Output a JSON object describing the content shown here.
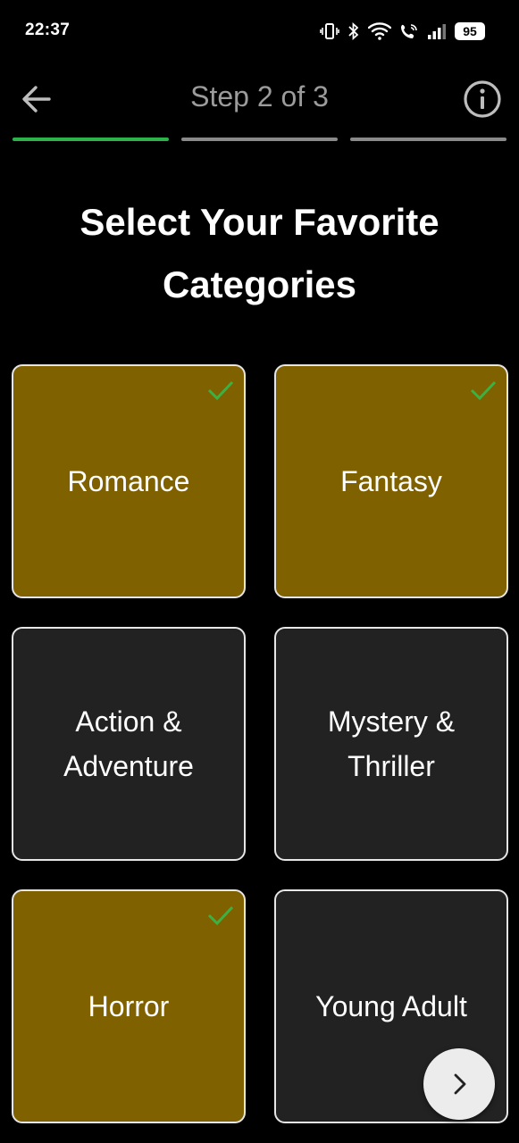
{
  "status_bar": {
    "time": "22:37",
    "battery": "95",
    "icons": [
      "vibrate-icon",
      "bluetooth-icon",
      "wifi-icon",
      "wifi-calling-icon",
      "signal-icon",
      "battery-icon"
    ]
  },
  "header": {
    "step_label": "Step 2 of 3",
    "back_icon": "arrow-left-icon",
    "info_icon": "info-icon"
  },
  "progress": {
    "current_step": 2,
    "total_steps": 3,
    "active_color": "#2db34a",
    "inactive_color": "#8a8a8a"
  },
  "title": "Select Your Favorite Categories",
  "categories": [
    {
      "label": "Romance",
      "selected": true
    },
    {
      "label": "Fantasy",
      "selected": true
    },
    {
      "label": "Action &\nAdventure",
      "selected": false
    },
    {
      "label": "Mystery &\nThriller",
      "selected": false
    },
    {
      "label": "Horror",
      "selected": true
    },
    {
      "label": "Young Adult",
      "selected": false
    }
  ],
  "colors": {
    "selected_card": "#806100",
    "unselected_card": "#222222",
    "check": "#3cb043"
  },
  "next_button": {
    "icon": "chevron-right-icon"
  }
}
